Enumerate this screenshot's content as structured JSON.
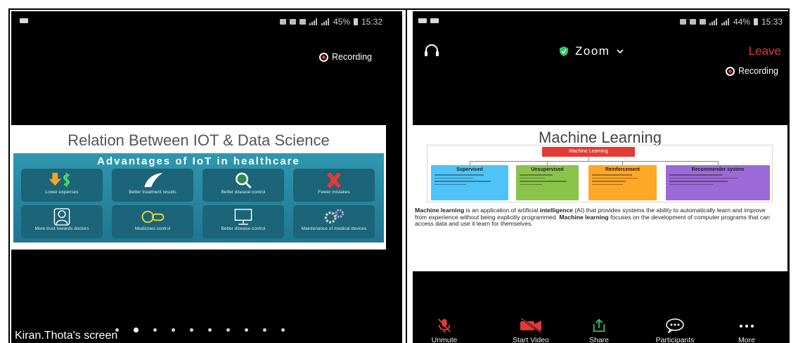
{
  "left_screen": {
    "status_bar": {
      "battery": "45%",
      "time": "15:32"
    },
    "recording_label": "Recording",
    "slide": {
      "title": "Relation Between IOT & Data Science",
      "infographic": {
        "heading": "Advantages of IoT in healthcare",
        "tiles": [
          {
            "label": "Lower expenses",
            "icon": "dollar-down-icon"
          },
          {
            "label": "Better treatment results",
            "icon": "leaf-icon"
          },
          {
            "label": "Better disease control",
            "icon": "magnifier-icon"
          },
          {
            "label": "Fewer mistakes",
            "icon": "x-mark-icon"
          },
          {
            "label": "More trust towards doctors",
            "icon": "doctor-icon"
          },
          {
            "label": "Medicines control",
            "icon": "pills-icon"
          },
          {
            "label": "Better disease control",
            "icon": "monitor-icon"
          },
          {
            "label": "Maintenance of medical devices",
            "icon": "gears-icon"
          }
        ]
      }
    },
    "page_indicator": {
      "total": 10,
      "active_index": 1
    },
    "screen_owner": "Kiran.Thota's screen"
  },
  "right_screen": {
    "status_bar": {
      "battery": "44%",
      "time": "15:33"
    },
    "top_bar": {
      "audio_icon": "headphone-icon",
      "security_icon": "shield-icon",
      "meeting_name": "Zoom",
      "leave_label": "Leave"
    },
    "recording_label": "Recording",
    "slide": {
      "title": "Machine Learning",
      "diagram": {
        "root": "Machine Learning",
        "branches": [
          "Supervised",
          "Unsupervised",
          "Reinforcement",
          "Recommender system"
        ]
      },
      "paragraph": [
        {
          "text": "Machine learning",
          "bold": true
        },
        {
          "text": " is an application of artificial ",
          "bold": false
        },
        {
          "text": "intelligence",
          "bold": true
        },
        {
          "text": " (AI) that provides systems the ability to automatically learn and improve from experience without being explicitly programmed. ",
          "bold": false
        },
        {
          "text": "Machine learning",
          "bold": true
        },
        {
          "text": " focuses on the development of computer programs that can access data and use it learn for themselves.",
          "bold": false
        }
      ]
    },
    "toolbar": [
      {
        "label": "Unmute",
        "icon": "muted-mic-icon"
      },
      {
        "label": "Start Video",
        "icon": "video-off-icon"
      },
      {
        "label": "Share",
        "icon": "share-icon"
      },
      {
        "label": "Participants",
        "icon": "participants-icon"
      },
      {
        "label": "More",
        "icon": "more-icon"
      }
    ]
  },
  "colors": {
    "leave_red": "#e53935",
    "infographic_teal": "#2a8ca3",
    "tile_teal": "#1c6478",
    "share_green": "#2ec46a",
    "supervised_blue": "#4fc3f7",
    "unsupervised_green": "#8bc34a",
    "reinforcement_orange": "#ffa726",
    "recommender_purple": "#9c6ad8"
  }
}
